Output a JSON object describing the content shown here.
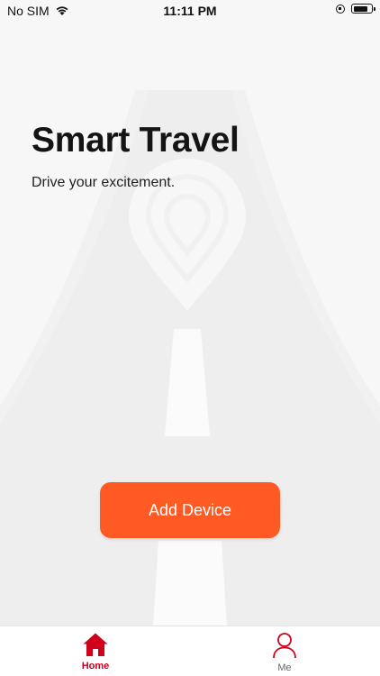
{
  "status_bar": {
    "carrier": "No SIM",
    "time": "11:11 PM",
    "battery_level": 0.85,
    "icons": [
      "wifi-icon",
      "orientation-lock-icon",
      "battery-icon"
    ]
  },
  "hero": {
    "title": "Smart Travel",
    "subtitle": "Drive your excitement."
  },
  "actions": {
    "add_device_label": "Add Device",
    "accent_color": "#ff5a24"
  },
  "tabbar": {
    "active_color": "#d0021b",
    "tabs": [
      {
        "label": "Home",
        "icon": "home-icon",
        "active": true
      },
      {
        "label": "Me",
        "icon": "person-icon",
        "active": false
      }
    ]
  }
}
